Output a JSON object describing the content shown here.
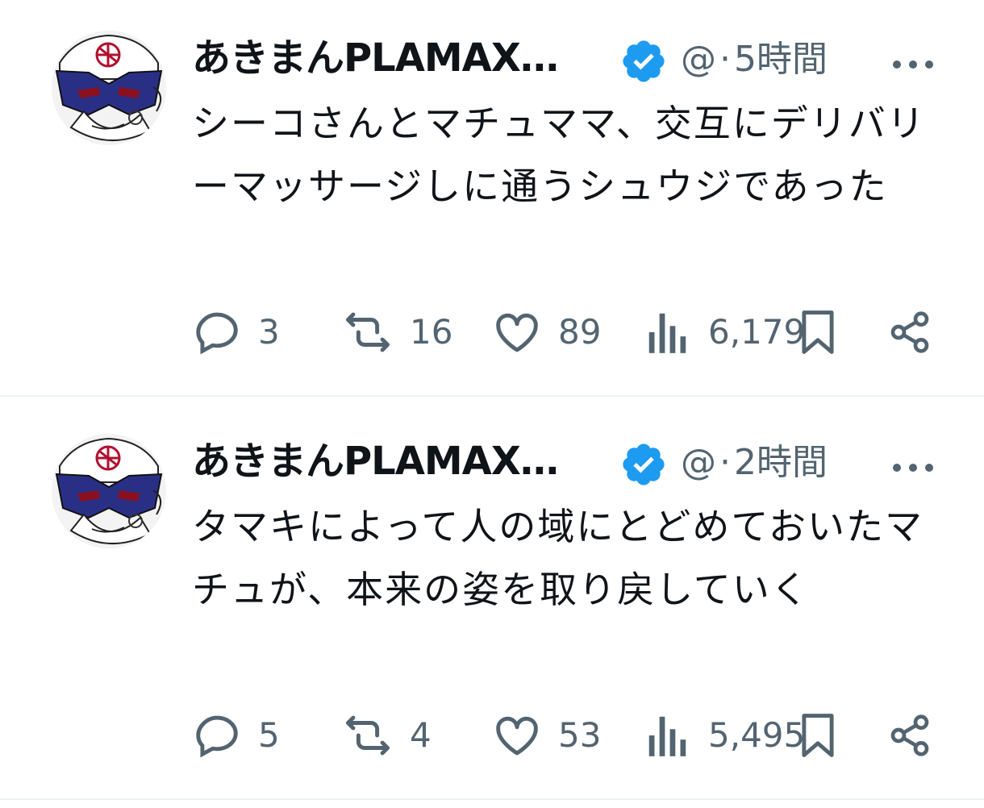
{
  "tweets": [
    {
      "author_name": "あきまんPLAMAX…",
      "handle": "@",
      "separator": "·",
      "time": "5時間",
      "text": "シーコさんとマチュママ、交互にデリバリーマッサージしに通うシュウジであった",
      "replies": "3",
      "retweets": "16",
      "likes": "89",
      "views": "6,179"
    },
    {
      "author_name": "あきまんPLAMAX…",
      "handle": "@",
      "separator": "·",
      "time": "2時間",
      "text": "タマキによって人の域にとどめておいたマチュが、本来の姿を取り戻していく",
      "replies": "5",
      "retweets": "4",
      "likes": "53",
      "views": "5,495"
    }
  ],
  "colors": {
    "verified": "#1d9bf0",
    "secondary_text": "#536471",
    "primary_text": "#0f1419",
    "divider": "#eff3f4"
  },
  "icons": [
    "avatar",
    "verified-badge-icon",
    "more-icon",
    "reply-icon",
    "retweet-icon",
    "like-icon",
    "views-icon",
    "bookmark-icon",
    "share-icon"
  ]
}
